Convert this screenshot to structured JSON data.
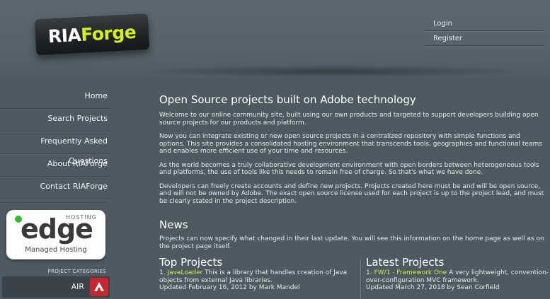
{
  "brand": {
    "logo_ria": "RIA",
    "logo_forge": "Forge",
    "accent_color": "#d6e83a"
  },
  "top_links": [
    {
      "label": "Login"
    },
    {
      "label": "Register"
    }
  ],
  "sidebar": {
    "items": [
      {
        "label": "Home"
      },
      {
        "label": "Search Projects"
      },
      {
        "label": "Frequently Asked Questions"
      },
      {
        "label": "About RIAForge"
      },
      {
        "label": "Contact RIAForge"
      }
    ],
    "edge_badge": {
      "word": "edge",
      "hosting": "HOSTING",
      "managed": "Managed Hosting"
    },
    "categories_title": "PROJECT CATEGORIES",
    "categories": [
      {
        "label": "AIR",
        "icon": "adobe-air-icon"
      }
    ]
  },
  "main": {
    "title": "Open Source projects built on Adobe technology",
    "paragraphs": [
      "Welcome to our online community site, built using our own products and targeted to support developers building open source projects for our products and platform.",
      "Now you can integrate existing or new open source projects in a centralized repository with simple functions and options. This site provides a consolidated hosting environment that transcends tools, geographies and functional teams and enables more efficient use of your time and resources.",
      "As the world becomes a truly collaborative development environment with open borders between heterogeneous tools and platforms, the use of tools like this needs to remain free of charge. So that's what we have done.",
      "Developers can freely create accounts and define new projects. Projects created here must be and will be open source, and will not be owned by Adobe. The exact open source license used for each project is up to the project lead, and must be clearly stated in the project description."
    ]
  },
  "news": {
    "title": "News",
    "text": "Projects can now specify what changed in their last update. You will see this information on the home page as well as on the project page itself."
  },
  "top_projects": {
    "title": "Top Projects",
    "items": [
      {
        "num": "1.",
        "name": "JavaLoader",
        "desc": " This is a library that handles creation of Java objects from external Java libraries.",
        "updated": "Updated February 16, 2012 by Mark Mandel"
      }
    ]
  },
  "latest_projects": {
    "title": "Latest Projects",
    "items": [
      {
        "num": "1.",
        "name": "FW/1 - Framework One",
        "desc": " A very lightweight, convention-over-configuration MVC framework.",
        "updated": "Updated March 27, 2018 by Sean Corfield"
      }
    ]
  }
}
